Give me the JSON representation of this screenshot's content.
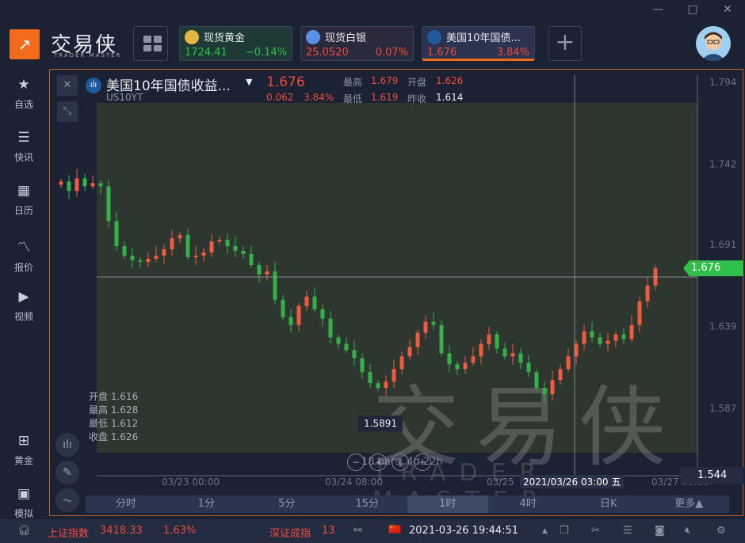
{
  "window": {
    "minimize": "—",
    "maximize": "□",
    "close": "✕"
  },
  "brand": {
    "name": "交易侠",
    "sub": "TRADER MASTER"
  },
  "tickers": [
    {
      "name": "现货黄金",
      "price": "1724.41",
      "change": "−0.14%",
      "dir": "down",
      "icon_color": "#e6b540",
      "icon": "gold-icon"
    },
    {
      "name": "现货白银",
      "price": "25.0520",
      "change": "0.07%",
      "dir": "up",
      "icon_color": "#5b8ee6",
      "icon": "silver-icon"
    },
    {
      "name": "美国10年国债...",
      "price": "1.676",
      "change": "3.84%",
      "dir": "up",
      "icon_color": "#1e5a9c",
      "icon": "bond-icon"
    }
  ],
  "sidebar": [
    {
      "label": "自选",
      "glyph": "★"
    },
    {
      "label": "快讯",
      "glyph": "☰"
    },
    {
      "label": "日历",
      "glyph": "▦"
    },
    {
      "label": "报价",
      "glyph": "〽"
    },
    {
      "label": "视频",
      "glyph": "▶"
    }
  ],
  "sidebar_bottom": [
    {
      "label": "黄金",
      "glyph": "⊞"
    },
    {
      "label": "模拟",
      "glyph": "▣"
    }
  ],
  "quote": {
    "title": "美国10年国债收益...",
    "symbol": "US10YT",
    "price": "1.676",
    "change": "0.062",
    "change_pct": "3.84%",
    "high_label": "最高",
    "high": "1.679",
    "open_label": "开盘",
    "open": "1.626",
    "low_label": "最低",
    "low": "1.619",
    "prev_label": "昨收",
    "prev": "1.614"
  },
  "ohlc_box": [
    {
      "k": "开盘",
      "v": "1.616"
    },
    {
      "k": "最高",
      "v": "1.628"
    },
    {
      "k": "最低",
      "v": "1.612"
    },
    {
      "k": "收盘",
      "v": "1.626"
    }
  ],
  "crosshair": {
    "price": "1.5891",
    "date": "2021/03/26 03:00 五",
    "axis_price": "1.544"
  },
  "range_info": "18 bars, 4d 22h",
  "watermark": {
    "cn": "交易侠",
    "en": "TRADER MASTER"
  },
  "colors": {
    "up": "#f05a3e",
    "down": "#35b14a",
    "accent": "#f26a1b"
  },
  "chart_data": {
    "type": "candlestick",
    "y_ticks": [
      "1.794",
      "1.742",
      "1.691",
      "1.639",
      "1.587"
    ],
    "ylim": [
      1.587,
      1.794
    ],
    "x_ticks": [
      "03/23 00:00",
      "03/24 08:00",
      "03/25",
      "03/27 00:00"
    ],
    "last_price": "1.676",
    "closes": [
      1.731,
      1.725,
      1.733,
      1.728,
      1.73,
      1.728,
      1.706,
      1.69,
      1.684,
      1.681,
      1.68,
      1.682,
      1.684,
      1.688,
      1.695,
      1.697,
      1.683,
      1.684,
      1.686,
      1.693,
      1.694,
      1.69,
      1.687,
      1.685,
      1.678,
      1.672,
      1.674,
      1.656,
      1.645,
      1.64,
      1.652,
      1.658,
      1.65,
      1.644,
      1.632,
      1.628,
      1.624,
      1.619,
      1.61,
      1.603,
      1.6,
      1.604,
      1.612,
      1.62,
      1.626,
      1.635,
      1.642,
      1.64,
      1.622,
      1.615,
      1.612,
      1.616,
      1.62,
      1.628,
      1.634,
      1.625,
      1.62,
      1.622,
      1.616,
      1.61,
      1.6,
      1.596,
      1.605,
      1.612,
      1.62,
      1.628,
      1.636,
      1.632,
      1.628,
      1.63,
      1.634,
      1.631,
      1.64,
      1.655,
      1.665,
      1.676
    ]
  },
  "periods": [
    {
      "label": "分时"
    },
    {
      "label": "1分"
    },
    {
      "label": "5分"
    },
    {
      "label": "15分"
    },
    {
      "label": "1时",
      "active": true
    },
    {
      "label": "4时"
    },
    {
      "label": "日K"
    },
    {
      "label": "更多▲"
    }
  ],
  "status": {
    "idx1_name": "上证指数",
    "idx1_val": "3418.33",
    "idx1_pct": "1.63%",
    "idx2_name": "深证成指",
    "idx2_val": "13",
    "datetime": "2021-03-26 19:44:51",
    "flag": "🇨🇳"
  }
}
